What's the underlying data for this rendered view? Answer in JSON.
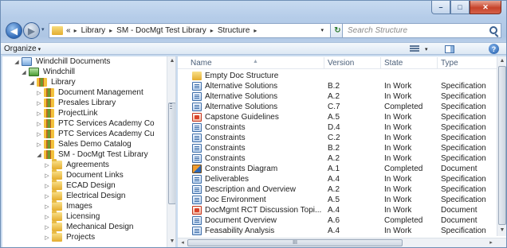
{
  "window": {
    "caption": {
      "minimize": "–",
      "maximize": "□",
      "close": "✕"
    }
  },
  "address_bar": {
    "overflow": "«",
    "crumbs": [
      "Library",
      "SM - DocMgt Test Library",
      "Structure"
    ],
    "chevron": "▸",
    "dropdown": "▾",
    "refresh": "↻"
  },
  "search": {
    "placeholder": "Search Structure",
    "icon": "search-icon"
  },
  "toolbar": {
    "organize_label": "Organize",
    "organize_caret": "▾",
    "view_caret": "▾",
    "help": "?"
  },
  "nav_tree": [
    {
      "label": "Windchill Documents",
      "expand": "◢",
      "icon": "windchill-documents-icon"
    },
    {
      "label": "Windchill",
      "expand": "◢",
      "icon": "windchill-icon"
    },
    {
      "label": "Library",
      "expand": "◢",
      "icon": "library-icon"
    },
    {
      "label": "Document Management",
      "expand": "▷",
      "icon": "library-icon"
    },
    {
      "label": "Presales Library",
      "expand": "▷",
      "icon": "library-icon"
    },
    {
      "label": "ProjectLink",
      "expand": "▷",
      "icon": "library-icon"
    },
    {
      "label": "PTC Services Academy Co",
      "expand": "▷",
      "icon": "library-icon"
    },
    {
      "label": "PTC Services Academy Cu",
      "expand": "▷",
      "icon": "library-icon"
    },
    {
      "label": "Sales Demo Catalog",
      "expand": "▷",
      "icon": "library-icon"
    },
    {
      "label": "SM - DocMgt Test Library",
      "expand": "◢",
      "icon": "library-icon"
    },
    {
      "label": "Agreements",
      "expand": "▷",
      "icon": "folder-icon"
    },
    {
      "label": "Document Links",
      "expand": "▷",
      "icon": "folder-icon"
    },
    {
      "label": "ECAD Design",
      "expand": "▷",
      "icon": "folder-icon"
    },
    {
      "label": "Electrical Design",
      "expand": "▷",
      "icon": "folder-icon"
    },
    {
      "label": "Images",
      "expand": "▷",
      "icon": "folder-icon"
    },
    {
      "label": "Licensing",
      "expand": "▷",
      "icon": "folder-icon"
    },
    {
      "label": "Mechanical Design",
      "expand": "▷",
      "icon": "folder-icon"
    },
    {
      "label": "Projects",
      "expand": "▷",
      "icon": "folder-icon"
    }
  ],
  "columns": {
    "name": "Name",
    "version": "Version",
    "state": "State",
    "type": "Type",
    "sort_indicator": "▲"
  },
  "files": [
    {
      "name": "Empty Doc Structure",
      "version": "",
      "state": "",
      "type": "",
      "icon": "folder"
    },
    {
      "name": "Alternative Solutions",
      "version": "B.2",
      "state": "In Work",
      "type": "Specification",
      "icon": "doc"
    },
    {
      "name": "Alternative Solutions",
      "version": "A.2",
      "state": "In Work",
      "type": "Specification",
      "icon": "doc"
    },
    {
      "name": "Alternative Solutions",
      "version": "C.7",
      "state": "Completed",
      "type": "Specification",
      "icon": "doc"
    },
    {
      "name": "Capstone Guidelines",
      "version": "A.5",
      "state": "In Work",
      "type": "Specification",
      "icon": "pdf"
    },
    {
      "name": "Constraints",
      "version": "D.4",
      "state": "In Work",
      "type": "Specification",
      "icon": "doc"
    },
    {
      "name": "Constraints",
      "version": "C.2",
      "state": "In Work",
      "type": "Specification",
      "icon": "doc"
    },
    {
      "name": "Constraints",
      "version": "B.2",
      "state": "In Work",
      "type": "Specification",
      "icon": "doc"
    },
    {
      "name": "Constraints",
      "version": "A.2",
      "state": "In Work",
      "type": "Specification",
      "icon": "doc"
    },
    {
      "name": "Constraints Diagram",
      "version": "A.1",
      "state": "Completed",
      "type": "Document",
      "icon": "diagram"
    },
    {
      "name": "Deliverables",
      "version": "A.4",
      "state": "In Work",
      "type": "Specification",
      "icon": "doc"
    },
    {
      "name": "Description and Overview",
      "version": "A.2",
      "state": "In Work",
      "type": "Specification",
      "icon": "doc"
    },
    {
      "name": "Doc Environment",
      "version": "A.5",
      "state": "In Work",
      "type": "Specification",
      "icon": "doc"
    },
    {
      "name": "DocMgmt RCT Discussion Topi...",
      "version": "A.4",
      "state": "In Work",
      "type": "Document",
      "icon": "pdf"
    },
    {
      "name": "Document Overview",
      "version": "A.6",
      "state": "Completed",
      "type": "Document",
      "icon": "doc"
    },
    {
      "name": "Feasability Analysis",
      "version": "A.4",
      "state": "In Work",
      "type": "Specification",
      "icon": "doc"
    }
  ],
  "scrollbar": {
    "up": "▲",
    "down": "▼",
    "left": "◂",
    "right": "▸",
    "grip": "III"
  }
}
